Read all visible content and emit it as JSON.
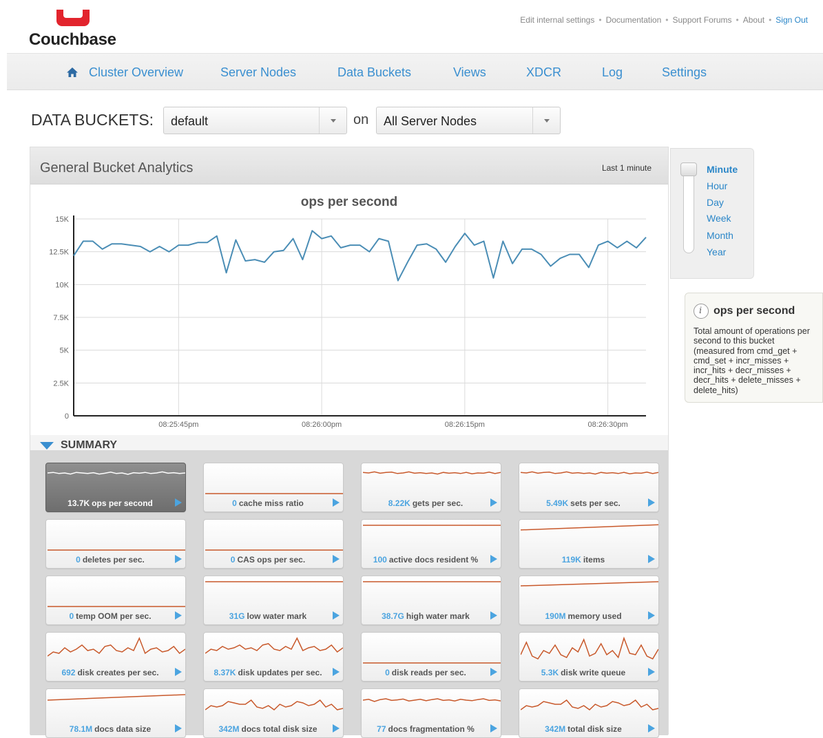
{
  "app": {
    "logo_text": "Couchbase",
    "accent": "#3a8fd0",
    "brand_red": "#e2242d"
  },
  "top_links": [
    "Edit internal settings",
    "Documentation",
    "Support Forums",
    "About",
    "Sign Out"
  ],
  "link_separator": "•",
  "nav": {
    "items": [
      "Cluster Overview",
      "Server Nodes",
      "Data Buckets",
      "Views",
      "XDCR",
      "Log",
      "Settings"
    ],
    "home_icon": "home-icon"
  },
  "bucket_bar": {
    "label": "DATA BUCKETS:",
    "bucket_value": "default",
    "on_label": "on",
    "node_value": "All Server Nodes"
  },
  "analytics": {
    "title": "General Bucket Analytics",
    "range_label": "Last 1 minute",
    "summary_label": "SUMMARY"
  },
  "chart_data": {
    "type": "line",
    "title": "ops per second",
    "xlabel": "",
    "ylabel": "",
    "yticks": [
      "0",
      "2.5K",
      "5K",
      "7.5K",
      "10K",
      "12.5K",
      "15K"
    ],
    "ytick_values": [
      0,
      2500,
      5000,
      7500,
      10000,
      12500,
      15000
    ],
    "ylim": [
      0,
      15000
    ],
    "xticks": [
      "08:25:45pm",
      "08:26:00pm",
      "08:26:15pm",
      "08:26:30pm"
    ],
    "xtick_times": [
      8,
      23,
      38,
      53
    ],
    "xlim": [
      -3,
      57
    ],
    "grid": true,
    "line_color": "#4a8db5",
    "series": [
      {
        "x": [
          -3,
          -2,
          -1,
          0,
          1,
          2,
          3,
          4,
          5,
          6,
          7,
          8,
          9,
          10,
          11,
          12,
          13,
          14,
          15,
          16,
          17,
          18,
          19,
          20,
          21,
          22,
          23,
          24,
          25,
          26,
          27,
          28,
          29,
          30,
          31,
          32,
          33,
          34,
          35,
          36,
          37,
          38,
          39,
          40,
          41,
          42,
          43,
          44,
          45,
          46,
          47,
          48,
          49,
          50,
          51,
          52,
          53,
          54,
          55,
          56,
          57
        ],
        "values": [
          12200,
          13300,
          13300,
          12700,
          13100,
          13100,
          13000,
          12900,
          12500,
          12900,
          12500,
          13000,
          13000,
          13200,
          13200,
          13700,
          10900,
          13400,
          11800,
          11900,
          11700,
          12500,
          12600,
          13500,
          11900,
          14100,
          13500,
          13700,
          12800,
          13000,
          13000,
          12500,
          13500,
          13300,
          10300,
          11700,
          13000,
          13100,
          12700,
          11700,
          12900,
          13900,
          13000,
          13300,
          10500,
          13300,
          11600,
          12700,
          12700,
          12300,
          11400,
          12000,
          12300,
          12300,
          11300,
          13000,
          13300,
          12800,
          13300,
          12800,
          13600
        ]
      }
    ]
  },
  "zoom": {
    "options": [
      "Minute",
      "Hour",
      "Day",
      "Week",
      "Month",
      "Year"
    ],
    "selected": "Minute"
  },
  "info": {
    "title": "ops per second",
    "description": "Total amount of operations per second to this bucket (measured from cmd_get + cmd_set + incr_misses + incr_hits + decr_misses + decr_hits + delete_misses + delete_hits)"
  },
  "summary_tiles": [
    {
      "value": "13.7K",
      "label": "ops per second",
      "trend": [
        0.8,
        0.82,
        0.78,
        0.8,
        0.76,
        0.82,
        0.8,
        0.78,
        0.81,
        0.76,
        0.79,
        0.83,
        0.78,
        0.8,
        0.75,
        0.81,
        0.79,
        0.82,
        0.78,
        0.8,
        0.84,
        0.79,
        0.81,
        0.78,
        0.8
      ],
      "active": true
    },
    {
      "value": "0",
      "label": "cache miss ratio",
      "trend": [
        0.05,
        0.05
      ],
      "active": false
    },
    {
      "value": "8.22K",
      "label": "gets per sec.",
      "trend": [
        0.82,
        0.8,
        0.84,
        0.79,
        0.82,
        0.83,
        0.78,
        0.8,
        0.84,
        0.79,
        0.81,
        0.78,
        0.8,
        0.76,
        0.82,
        0.79,
        0.81,
        0.78,
        0.82,
        0.77,
        0.8,
        0.79,
        0.83,
        0.78,
        0.82
      ],
      "active": false
    },
    {
      "value": "5.49K",
      "label": "sets per sec.",
      "trend": [
        0.82,
        0.8,
        0.84,
        0.79,
        0.82,
        0.83,
        0.78,
        0.8,
        0.84,
        0.79,
        0.81,
        0.78,
        0.8,
        0.76,
        0.82,
        0.79,
        0.81,
        0.78,
        0.82,
        0.77,
        0.8,
        0.79,
        0.83,
        0.78,
        0.82
      ],
      "active": false
    },
    {
      "value": "0",
      "label": "deletes per sec.",
      "trend": [
        0.05,
        0.05
      ],
      "active": false
    },
    {
      "value": "0",
      "label": "CAS ops per sec.",
      "trend": [
        0.05,
        0.05
      ],
      "active": false
    },
    {
      "value": "100",
      "label": "active docs resident %",
      "trend": [
        0.95,
        0.95
      ],
      "active": false
    },
    {
      "value": "119K",
      "label": "items",
      "trend": [
        0.78,
        0.97
      ],
      "active": false
    },
    {
      "value": "0",
      "label": "temp OOM per sec.",
      "trend": [
        0.05,
        0.05
      ],
      "active": false
    },
    {
      "value": "31G",
      "label": "low water mark",
      "trend": [
        0.95,
        0.95
      ],
      "active": false
    },
    {
      "value": "38.7G",
      "label": "high water mark",
      "trend": [
        0.95,
        0.95
      ],
      "active": false
    },
    {
      "value": "190M",
      "label": "memory used",
      "trend": [
        0.8,
        0.95
      ],
      "active": false
    },
    {
      "value": "692",
      "label": "disk creates per sec.",
      "trend": [
        0.3,
        0.45,
        0.4,
        0.6,
        0.45,
        0.55,
        0.7,
        0.5,
        0.55,
        0.4,
        0.65,
        0.7,
        0.5,
        0.45,
        0.6,
        0.5,
        0.95,
        0.4,
        0.55,
        0.6,
        0.45,
        0.5,
        0.65,
        0.4,
        0.55
      ],
      "active": false
    },
    {
      "value": "8.37K",
      "label": "disk updates per sec.",
      "trend": [
        0.4,
        0.55,
        0.5,
        0.65,
        0.55,
        0.6,
        0.7,
        0.55,
        0.6,
        0.5,
        0.7,
        0.75,
        0.55,
        0.5,
        0.65,
        0.55,
        0.95,
        0.5,
        0.6,
        0.65,
        0.5,
        0.55,
        0.7,
        0.45,
        0.6
      ],
      "active": false
    },
    {
      "value": "0",
      "label": "disk reads per sec.",
      "trend": [
        0.05,
        0.05
      ],
      "active": false
    },
    {
      "value": "5.3K",
      "label": "disk write queue",
      "trend": [
        0.35,
        0.8,
        0.3,
        0.2,
        0.5,
        0.4,
        0.7,
        0.35,
        0.25,
        0.6,
        0.45,
        0.9,
        0.3,
        0.4,
        0.75,
        0.35,
        0.5,
        0.25,
        0.95,
        0.4,
        0.35,
        0.7,
        0.3,
        0.2,
        0.55
      ],
      "active": false
    },
    {
      "value": "78.1M",
      "label": "docs data size",
      "trend": [
        0.75,
        0.95
      ],
      "active": false
    },
    {
      "value": "342M",
      "label": "docs total disk size",
      "trend": [
        0.4,
        0.55,
        0.5,
        0.55,
        0.7,
        0.65,
        0.6,
        0.6,
        0.75,
        0.5,
        0.45,
        0.55,
        0.4,
        0.6,
        0.5,
        0.55,
        0.7,
        0.65,
        0.55,
        0.6,
        0.75,
        0.5,
        0.6,
        0.4,
        0.45
      ],
      "active": false
    },
    {
      "value": "77",
      "label": "docs fragmentation %",
      "trend": [
        0.75,
        0.78,
        0.7,
        0.77,
        0.8,
        0.74,
        0.76,
        0.79,
        0.72,
        0.75,
        0.78,
        0.73,
        0.77,
        0.8,
        0.74,
        0.76,
        0.72,
        0.78,
        0.75,
        0.73,
        0.77,
        0.8,
        0.74,
        0.76,
        0.72
      ],
      "active": false
    },
    {
      "value": "342M",
      "label": "total disk size",
      "trend": [
        0.4,
        0.55,
        0.5,
        0.55,
        0.7,
        0.65,
        0.6,
        0.6,
        0.75,
        0.5,
        0.45,
        0.55,
        0.4,
        0.6,
        0.5,
        0.55,
        0.7,
        0.65,
        0.55,
        0.6,
        0.75,
        0.5,
        0.6,
        0.4,
        0.45
      ],
      "active": false
    }
  ]
}
